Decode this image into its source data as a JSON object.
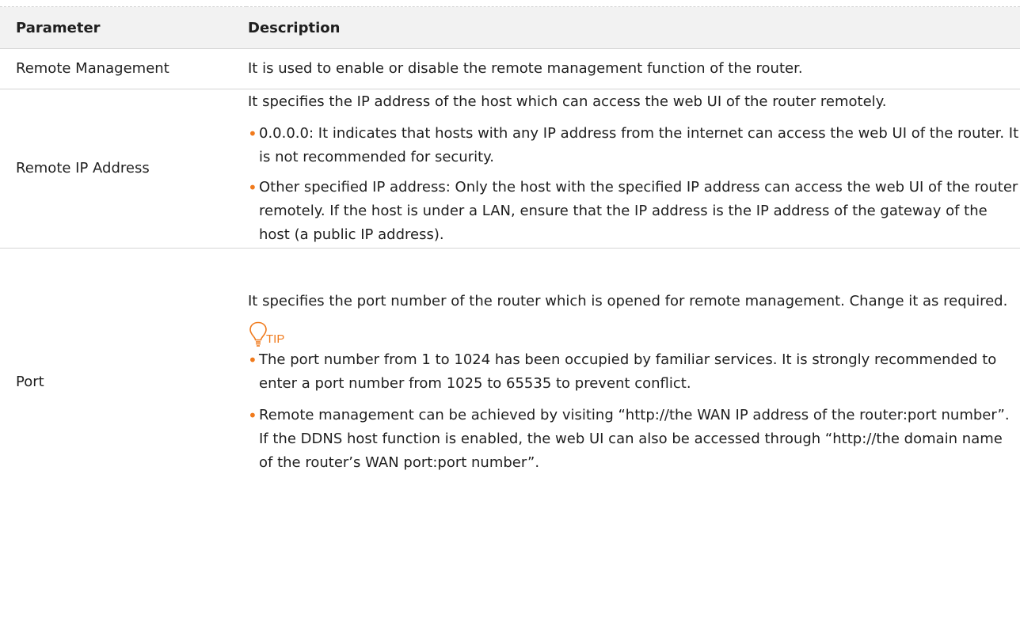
{
  "table": {
    "headers": {
      "parameter": "Parameter",
      "description": "Description"
    },
    "rows": {
      "remote_management": {
        "name": "Remote Management",
        "text": "It is used to enable or disable the remote management function of the router."
      },
      "remote_ip": {
        "name": "Remote IP Address",
        "intro": "It specifies the IP address of the host which can access the web UI of the router remotely.",
        "bullets": [
          "0.0.0.0: It indicates that hosts with any IP address from the internet can access the web UI of the router. It is not recommended for security.",
          "Other specified IP address: Only the host with the specified IP address can access the web UI of the router remotely. If the host is under a LAN, ensure that the IP address is the IP address of the gateway of the host (a public IP address)."
        ]
      },
      "port": {
        "name": "Port",
        "intro": "It specifies the port number of the router which is opened for remote management. Change it as required.",
        "tip_label": "TIP",
        "tip_icon": "lightbulb-icon",
        "bullets": [
          "The port number from 1 to 1024 has been occupied by familiar services. It is strongly recommended to enter a port number from 1025 to 65535 to prevent conflict.",
          "Remote management can be achieved by visiting “http://the WAN IP address of the router:port number”. If the DDNS host function is enabled, the web UI can also be accessed through “http://the domain name of the router’s WAN port:port number”."
        ]
      }
    }
  },
  "colors": {
    "header_bg": "#f2f2f2",
    "accent": "#f07a1c",
    "divider": "#d4d4d4"
  }
}
